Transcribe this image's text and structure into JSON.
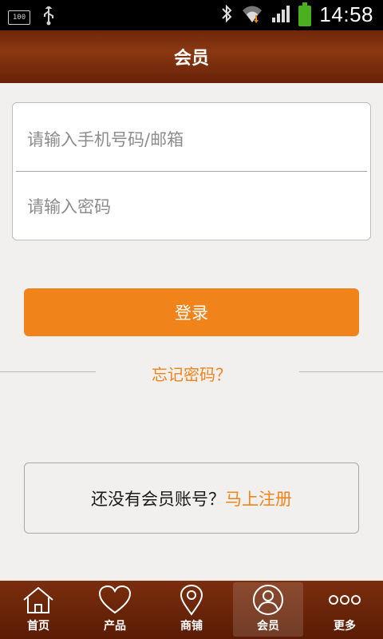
{
  "status_bar": {
    "battery_small_label": "100",
    "time": "14:58",
    "icons": [
      "battery-100-icon",
      "usb-icon",
      "bluetooth-icon",
      "wifi-icon",
      "signal-icon",
      "battery-icon"
    ]
  },
  "header": {
    "title": "会员"
  },
  "form": {
    "phone_placeholder": "请输入手机号码/邮箱",
    "password_placeholder": "请输入密码"
  },
  "login_button": "登录",
  "forgot_password": "忘记密码？",
  "register": {
    "prompt": "还没有会员账号？",
    "link": "马上注册"
  },
  "tabs": [
    {
      "label": "首页",
      "icon": "home-icon"
    },
    {
      "label": "产品",
      "icon": "heart-icon"
    },
    {
      "label": "商铺",
      "icon": "location-pin-icon"
    },
    {
      "label": "会员",
      "icon": "user-icon",
      "active": true
    },
    {
      "label": "更多",
      "icon": "more-icon"
    }
  ],
  "colors": {
    "accent": "#f08319",
    "header": "#7a2e0d",
    "background": "#f1f0ef"
  }
}
